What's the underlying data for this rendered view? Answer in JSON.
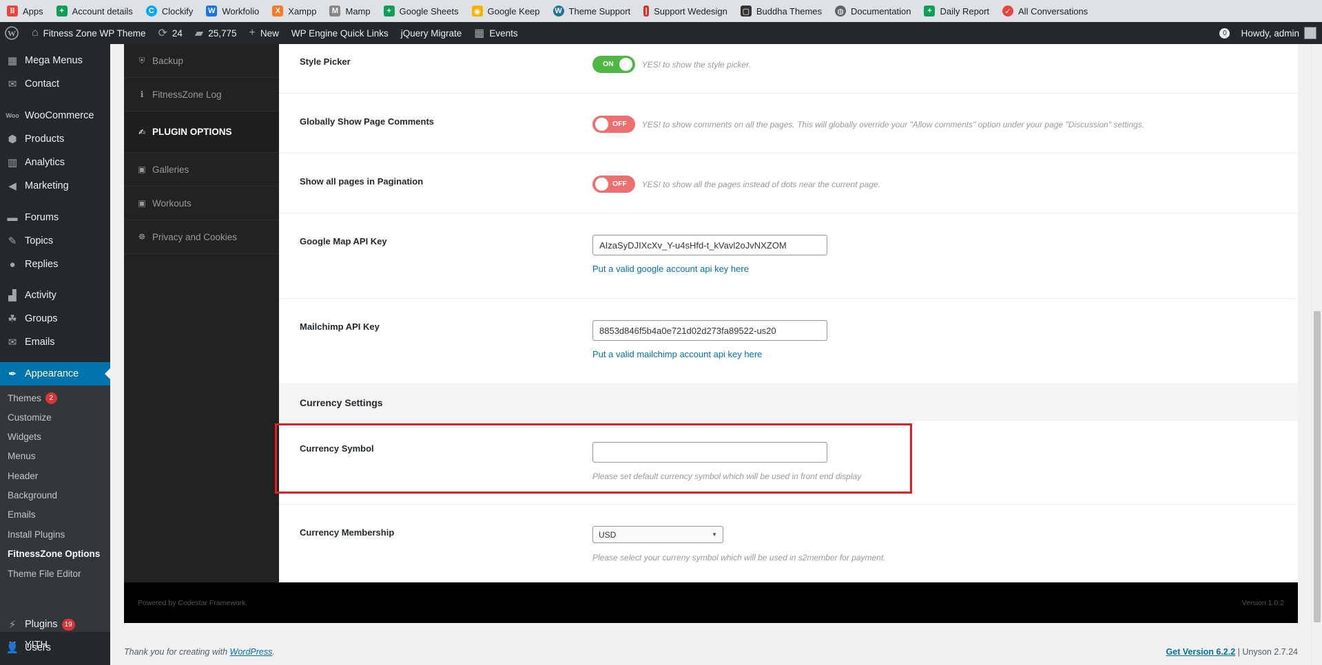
{
  "bookmarks": [
    {
      "label": "Apps",
      "icon": "apps-grid-icon",
      "color": "#e8453c"
    },
    {
      "label": "Account details",
      "icon": "sheets-icon",
      "color": "#0f9d58"
    },
    {
      "label": "Clockify",
      "icon": "clockify-icon",
      "color": "#03a9f4"
    },
    {
      "label": "Workfolio",
      "icon": "workfolio-icon",
      "color": "#1a73e8"
    },
    {
      "label": "Xampp",
      "icon": "xampp-icon",
      "color": "#fb7a24"
    },
    {
      "label": "Mamp",
      "icon": "mamp-icon",
      "color": "#888888"
    },
    {
      "label": "Google Sheets",
      "icon": "sheets-icon",
      "color": "#0f9d58"
    },
    {
      "label": "Google Keep",
      "icon": "keep-icon",
      "color": "#f4b400"
    },
    {
      "label": "Theme Support",
      "icon": "wordpress-icon",
      "color": "#21759b"
    },
    {
      "label": "Support Wedesign",
      "icon": "wedesign-icon",
      "color": "#d93025"
    },
    {
      "label": "Buddha Themes",
      "icon": "buddha-icon",
      "color": "#333333"
    },
    {
      "label": "Documentation",
      "icon": "globe-icon",
      "color": "#5f6368"
    },
    {
      "label": "Daily Report",
      "icon": "sheets-icon",
      "color": "#0f9d58"
    },
    {
      "label": "All Conversations",
      "icon": "chat-icon",
      "color": "#e8453c"
    }
  ],
  "adminbar": {
    "site_name": "Fitness Zone WP Theme",
    "updates": "24",
    "comments": "25,775",
    "new_label": "New",
    "quick_links": "WP Engine Quick Links",
    "jquery": "jQuery Migrate",
    "events": "Events",
    "notif_count": "0",
    "howdy": "Howdy, admin"
  },
  "menu": {
    "mega_menus": "Mega Menus",
    "contact": "Contact",
    "woocommerce": "WooCommerce",
    "products": "Products",
    "analytics": "Analytics",
    "marketing": "Marketing",
    "forums": "Forums",
    "topics": "Topics",
    "replies": "Replies",
    "activity": "Activity",
    "groups": "Groups",
    "emails": "Emails",
    "appearance": "Appearance",
    "yith": "YITH",
    "plugins": "Plugins",
    "plugins_count": "19",
    "users": "Users",
    "sub": {
      "themes": "Themes",
      "themes_count": "2",
      "customize": "Customize",
      "widgets": "Widgets",
      "menus": "Menus",
      "header": "Header",
      "background": "Background",
      "emails": "Emails",
      "install_plugins": "Install Plugins",
      "fitnesszone_options": "FitnessZone Options",
      "theme_file_editor": "Theme File Editor"
    }
  },
  "cs_nav": {
    "backup": "Backup",
    "log": "FitnessZone Log",
    "plugin_options": "Plugin Options",
    "galleries": "Galleries",
    "workouts": "Workouts",
    "privacy": "Privacy and Cookies"
  },
  "fields": {
    "style_picker": {
      "label": "Style Picker",
      "state": "ON",
      "help": "YES! to show the style picker."
    },
    "page_comments": {
      "label": "Globally Show Page Comments",
      "state": "OFF",
      "help": "YES! to show comments on all the pages. This will globally override your \"Allow comments\" option under your page \"Discussion\" settings."
    },
    "pagination": {
      "label": "Show all pages in Pagination",
      "state": "OFF",
      "help": "YES! to show all the pages instead of dots near the current page."
    },
    "gmap": {
      "label": "Google Map API Key",
      "value": "AIzaSyDJIXcXv_Y-u4sHfd-t_kVavl2oJvNXZOM",
      "link": "Put a valid google account api key here"
    },
    "mailchimp": {
      "label": "Mailchimp API Key",
      "value": "8853d846f5b4a0e721d02d273fa89522-us20",
      "link": "Put a valid mailchimp account api key here"
    },
    "currency_section": "Currency Settings",
    "currency_symbol": {
      "label": "Currency Symbol",
      "value": "",
      "desc": "Please set default currency symbol which will be used in front end display"
    },
    "currency_membership": {
      "label": "Currency Membership",
      "value": "USD",
      "desc": "Please select your curreny symbol which will be used in s2member for payment."
    }
  },
  "cs_footer": {
    "left": "Powered by Codestar Framework.",
    "right": "Version 1.0.2"
  },
  "wp_footer": {
    "thanks": "Thank you for creating with ",
    "wp_link": "WordPress",
    "period": ".",
    "get_version": "Get Version 6.2.2",
    "separator": " | ",
    "unyson": "Unyson 2.7.24"
  },
  "colors": {
    "accent": "#0073aa",
    "on": "#4fb845",
    "off": "#ed6f6f",
    "highlight": "#e31e24"
  }
}
